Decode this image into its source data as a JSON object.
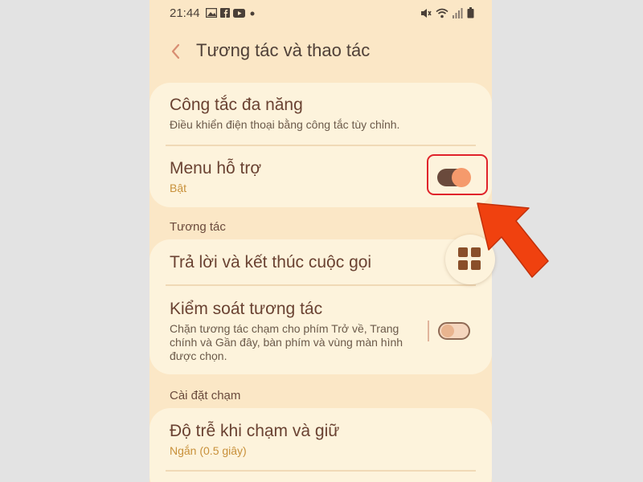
{
  "status_bar": {
    "time": "21:44",
    "left_icons": [
      "image-icon",
      "facebook-icon",
      "youtube-icon",
      "dot-icon"
    ],
    "right_icons": [
      "mute-icon",
      "wifi-icon",
      "signal-icon",
      "battery-icon"
    ]
  },
  "header": {
    "back_icon": "chevron-left-icon",
    "title": "Tương tác và thao tác"
  },
  "card1": {
    "items": [
      {
        "title": "Công tắc đa năng",
        "subtitle": "Điều khiển điện thoại bằng công tắc tùy chỉnh."
      },
      {
        "title": "Menu hỗ trợ",
        "value": "Bật",
        "toggle_on": true
      }
    ]
  },
  "section_interaction": {
    "label": "Tương tác"
  },
  "card2": {
    "items": [
      {
        "title": "Trả lời và kết thúc cuộc gọi"
      },
      {
        "title": "Kiểm soát tương tác",
        "subtitle_lines": [
          "Chặn tương tác chạm cho phím Trở về, Trang",
          "chính và Gần đây, bàn phím và vùng màn hình",
          "được chọn."
        ],
        "toggle_on": false
      }
    ]
  },
  "section_touch": {
    "label": "Cài đặt chạm"
  },
  "card3": {
    "items": [
      {
        "title": "Độ trễ khi chạm và giữ",
        "value": "Ngắn (0.5 giây)"
      }
    ]
  },
  "overlay": {
    "assistant_menu_icon": "grid-icon",
    "highlight_color": "#e0232b",
    "arrow_color": "#f0410f"
  },
  "colors": {
    "screen_bg": "#fbe7c6",
    "card_bg": "#fdf3dc",
    "accent_value": "#c8903a",
    "title_text": "#6a4232"
  }
}
